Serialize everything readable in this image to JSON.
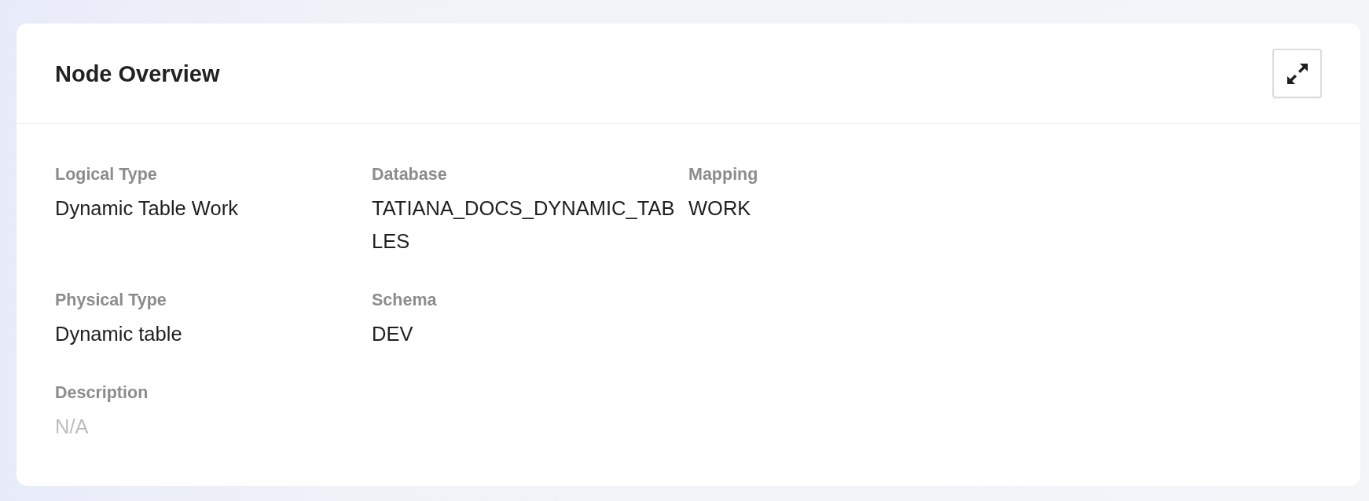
{
  "panel": {
    "title": "Node Overview"
  },
  "rows": [
    {
      "fields": [
        {
          "label": "Logical Type",
          "value": "Dynamic Table Work",
          "empty": false
        },
        {
          "label": "Database",
          "value": "TATIANA_DOCS_DYNAMIC_TABLES",
          "empty": false
        },
        {
          "label": "Mapping",
          "value": "WORK",
          "empty": false
        }
      ]
    },
    {
      "fields": [
        {
          "label": "Physical Type",
          "value": "Dynamic table",
          "empty": false
        },
        {
          "label": "Schema",
          "value": "DEV",
          "empty": false
        }
      ]
    },
    {
      "fields": [
        {
          "label": "Description",
          "value": "N/A",
          "empty": true
        }
      ]
    }
  ]
}
